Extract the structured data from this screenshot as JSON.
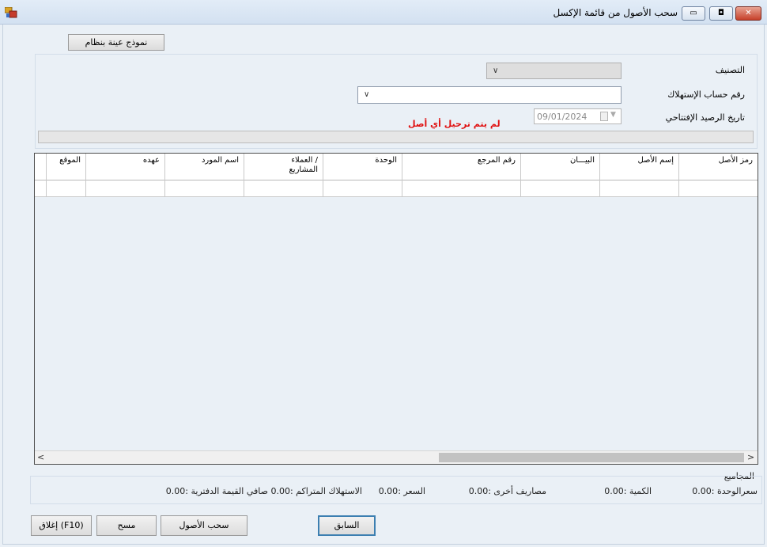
{
  "window": {
    "title": "سحب الأصول من قائمة الإكسل",
    "minimize_glyph": "▭",
    "maximize_glyph": "◘",
    "close_glyph": "✕",
    "icon": "app-window-icon"
  },
  "toolbar": {
    "sample_button": "نموذج عينة بنظام"
  },
  "filters": {
    "category_label": "التصنيف",
    "category_value": "",
    "account_label": "رقم حساب الإستهلاك",
    "account_value": "",
    "date_label": "تاريخ الرصيد الإفتتاحي",
    "date_value": "09/01/2024",
    "chevron": "∨",
    "date_arrow": "▼"
  },
  "status": {
    "message": "لم يتم ترحيل أي أصل",
    "progress": 0,
    "progress_color": "#3fb04a",
    "message_color": "#e01010"
  },
  "grid": {
    "columns": [
      "رمز الأصل",
      "إسم الأصل",
      "البيـــان",
      "رقم المرجع",
      "الوحدة",
      "العملاء /\nالمشاريع",
      "اسم المورد",
      "عهده",
      "الموقع"
    ],
    "rows": [],
    "scroll_left": "<",
    "scroll_right": ">"
  },
  "totals": {
    "title": "المجاميع",
    "unit_price": "سعرالوحدة :0.00",
    "quantity": "الكمية :0.00",
    "other_expenses": "مصاريف أخرى :0.00",
    "price": "السعر :0.00",
    "depreciation_net": "الاستهلاك المتراكم :0.00 صافي القيمة الدفترية :0.00"
  },
  "buttons": {
    "previous": "السابق",
    "import_assets": "سحب الأصول",
    "clear": "مسح",
    "close": "إغلاق (F10)"
  }
}
